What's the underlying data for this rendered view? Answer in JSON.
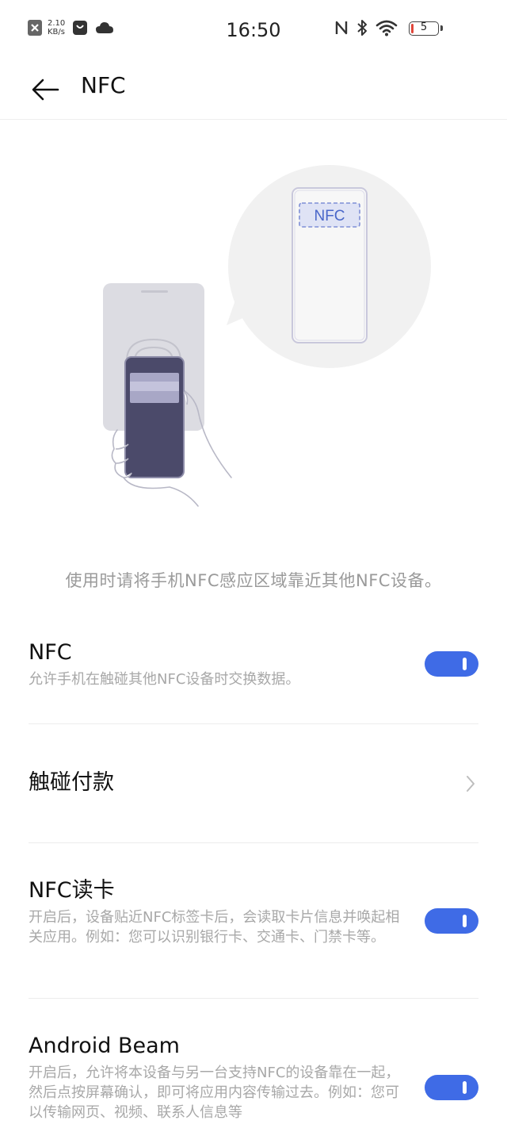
{
  "status_bar": {
    "speed_value": "2.10",
    "speed_unit": "KB/s",
    "time": "16:50",
    "battery": "5",
    "battery_level": 0.05,
    "icons": [
      "data-off-icon",
      "bag-icon",
      "cloud-icon",
      "nfc-status-icon",
      "bluetooth-icon",
      "wifi-icon",
      "battery-icon"
    ]
  },
  "header": {
    "back_icon": "arrow-left-icon",
    "title": "NFC"
  },
  "illustration": {
    "bubble_label": "NFC"
  },
  "hint": "使用时请将手机NFC感应区域靠近其他NFC设备。",
  "settings": {
    "nfc": {
      "title": "NFC",
      "desc": "允许手机在触碰其他NFC设备时交换数据。",
      "enabled": true
    },
    "tap_pay": {
      "title": "触碰付款",
      "chevron_icon": "chevron-right-icon"
    },
    "nfc_read_card": {
      "title": "NFC读卡",
      "desc": "开启后，设备贴近NFC标签卡后，会读取卡片信息并唤起相关应用。例如：您可以识别银行卡、交通卡、门禁卡等。",
      "enabled": true
    },
    "android_beam": {
      "title": "Android Beam",
      "desc": "开启后，允许将本设备与另一台支持NFC的设备靠在一起，然后点按屏幕确认，即可将应用内容传输过去。例如：您可以传输网页、视频、联系人信息等",
      "enabled": true
    }
  },
  "colors": {
    "accent": "#3f6be6",
    "hint_text": "#9a9a9a",
    "desc_text": "#a8a8a8",
    "illustration_circle": "#f1f1f1",
    "phone_dark": "#4b4a6a"
  }
}
